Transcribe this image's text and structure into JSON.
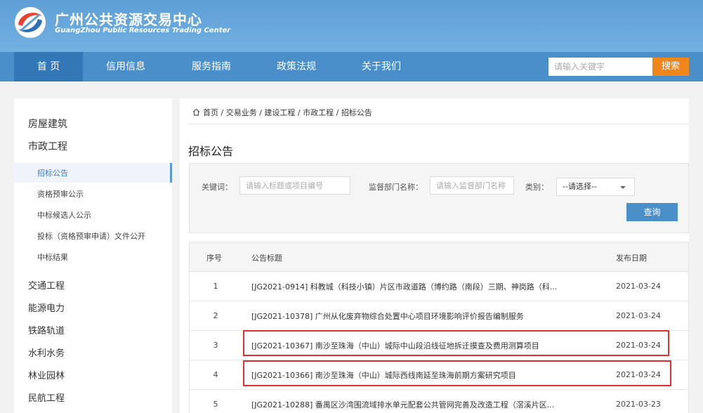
{
  "header": {
    "title": "广州公共资源交易中心",
    "subtitle": "GuangZhou Public Resources Trading Center"
  },
  "nav": {
    "items": [
      "首 页",
      "信用信息",
      "服务指南",
      "政策法规",
      "关于我们"
    ],
    "search_placeholder": "请输入关键字",
    "search_label": "搜索"
  },
  "sidebar": {
    "categories": [
      "房屋建筑",
      "市政工程",
      "交通工程",
      "能源电力",
      "铁路轨道",
      "水利水务",
      "林业园林",
      "民航工程"
    ],
    "subitems": [
      "招标公告",
      "资格预审公示",
      "中标候选人公示",
      "投标（资格预审申请）文件公开",
      "中标结果"
    ]
  },
  "breadcrumb": {
    "items": [
      "首页",
      "交易业务",
      "建设工程",
      "市政工程",
      "招标公告"
    ]
  },
  "section_title": "招标公告",
  "filter": {
    "keyword_label": "关键词：",
    "keyword_placeholder": "请输入标题或项目编号",
    "dept_label": "监督部门名称：",
    "dept_placeholder": "请输入监督部门名称",
    "category_label": "类别：",
    "category_value": "--请选择--",
    "query_label": "查询"
  },
  "table": {
    "headers": [
      "序号",
      "公告标题",
      "发布日期"
    ],
    "rows": [
      {
        "no": "1",
        "title": "[JG2021-0914] 科教城（科技小镇）片区市政道路（博约路（南段）三期、神岗路（科...",
        "date": "2021-03-24"
      },
      {
        "no": "2",
        "title": "[JG2021-10378] 广州从化废弃物综合处置中心项目环境影响评价报告编制服务",
        "date": "2021-03-24"
      },
      {
        "no": "3",
        "title": "[JG2021-10367] 南沙至珠海（中山）城际中山段沿线征地拆迁摸查及费用测算项目",
        "date": "2021-03-24"
      },
      {
        "no": "4",
        "title": "[JG2021-10366] 南沙至珠海（中山）城际西线南延至珠海前期方案研究项目",
        "date": "2021-03-24"
      },
      {
        "no": "5",
        "title": "[JG2021-10288] 番禺区沙湾围流域排水单元配套公共管网完善及改造工程（滘溪片区...",
        "date": "2021-03-23"
      }
    ]
  },
  "colors": {
    "header": "#5d9fd6",
    "nav": "#4a8fca",
    "nav_active": "#3477b6",
    "search_button": "#f08519",
    "highlight": "#e03030"
  }
}
